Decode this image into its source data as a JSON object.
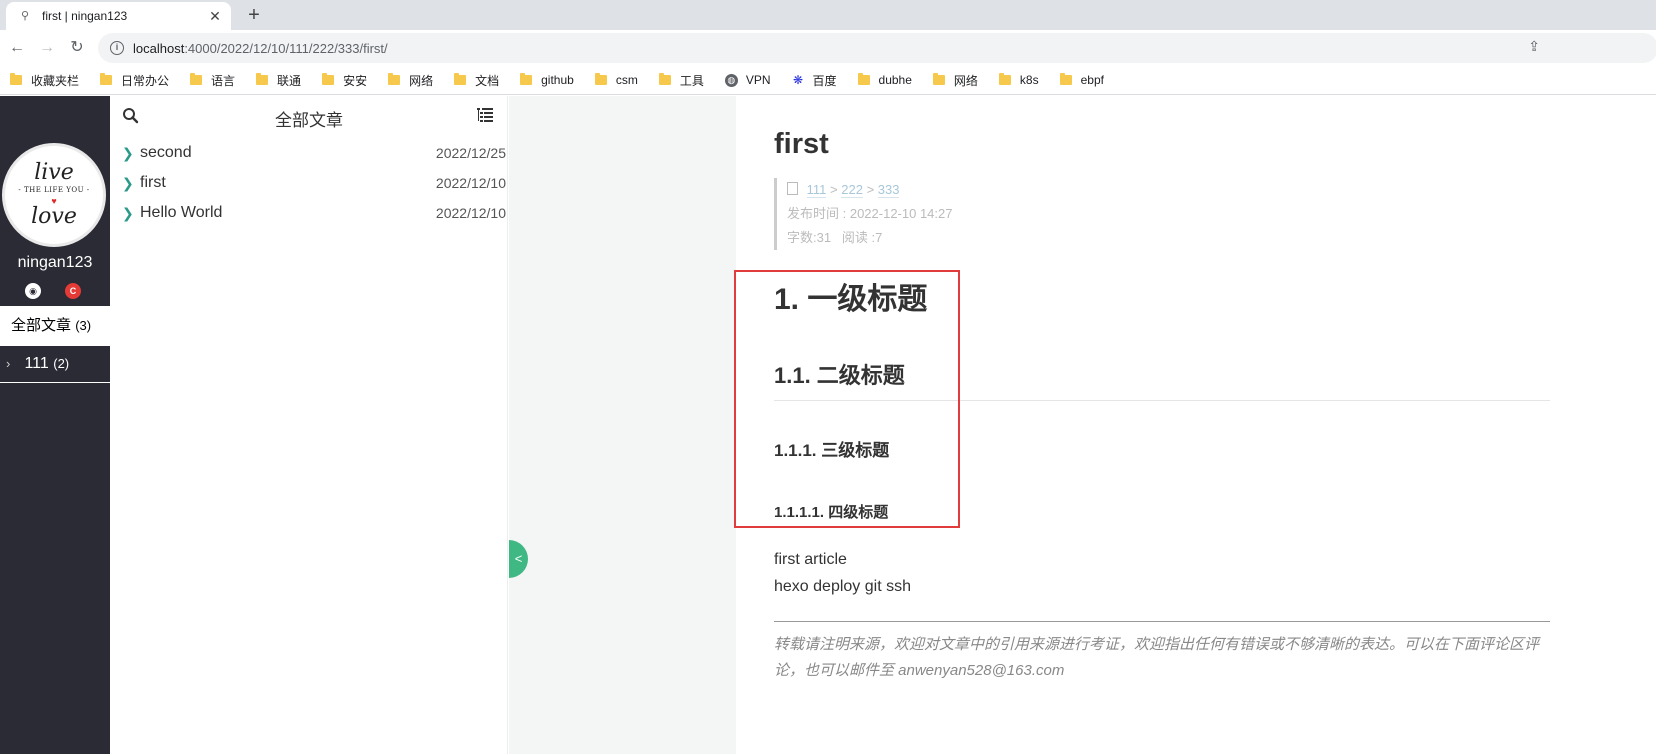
{
  "browser": {
    "tab_title": "first | ningan123",
    "tab_favicon": "hexo-favicon",
    "url_host": "localhost",
    "url_path": ":4000/2022/12/10/111/222/333/first/",
    "bookmarks": [
      {
        "label": "收藏夹栏",
        "icon": "folder-icon"
      },
      {
        "label": "日常办公",
        "icon": "folder-icon"
      },
      {
        "label": "语言",
        "icon": "folder-icon"
      },
      {
        "label": "联通",
        "icon": "folder-icon"
      },
      {
        "label": "安安",
        "icon": "folder-icon"
      },
      {
        "label": "网络",
        "icon": "folder-icon"
      },
      {
        "label": "文档",
        "icon": "folder-icon"
      },
      {
        "label": "github",
        "icon": "folder-icon"
      },
      {
        "label": "csm",
        "icon": "folder-icon"
      },
      {
        "label": "工具",
        "icon": "folder-icon"
      },
      {
        "label": "VPN",
        "icon": "globe-icon"
      },
      {
        "label": "百度",
        "icon": "baidu-paw-icon"
      },
      {
        "label": "dubhe",
        "icon": "folder-icon"
      },
      {
        "label": "网络",
        "icon": "folder-icon"
      },
      {
        "label": "k8s",
        "icon": "folder-icon"
      },
      {
        "label": "ebpf",
        "icon": "folder-icon"
      }
    ]
  },
  "sidebar": {
    "username": "ningan123",
    "avatar_text": {
      "top": "live",
      "middle": "- THE LIFE YOU -",
      "bottom": "love"
    },
    "all_articles": {
      "label": "全部文章",
      "count": "(3)"
    },
    "categories": [
      {
        "label": "111",
        "count": "(2)"
      }
    ]
  },
  "list": {
    "title": "全部文章",
    "items": [
      {
        "title": "second",
        "date": "2022/12/25"
      },
      {
        "title": "first",
        "date": "2022/12/10"
      },
      {
        "title": "Hello World",
        "date": "2022/12/10"
      }
    ]
  },
  "article": {
    "title": "first",
    "breadcrumb": [
      "111",
      "222",
      "333"
    ],
    "breadcrumb_sep": ">",
    "publish": "发布时间 : 2022-12-10 14:27",
    "words": "字数:31",
    "reads": "阅读 :7",
    "h1": "1. 一级标题",
    "h2": "1.1. 二级标题",
    "h3": "1.1.1. 三级标题",
    "h4": "1.1.1.1. 四级标题",
    "paragraphs": [
      "first article",
      "hexo deploy git ssh"
    ],
    "notice": "转载请注明来源，欢迎对文章中的引用来源进行考证，欢迎指出任何有错误或不够清晰的表达。可以在下面评论区评论，也可以邮件至 anwenyan528@163.com"
  },
  "colors": {
    "sidebar_bg": "#2a2b34",
    "accent_green": "#3fb883",
    "highlight_box": "#e13b3b"
  }
}
